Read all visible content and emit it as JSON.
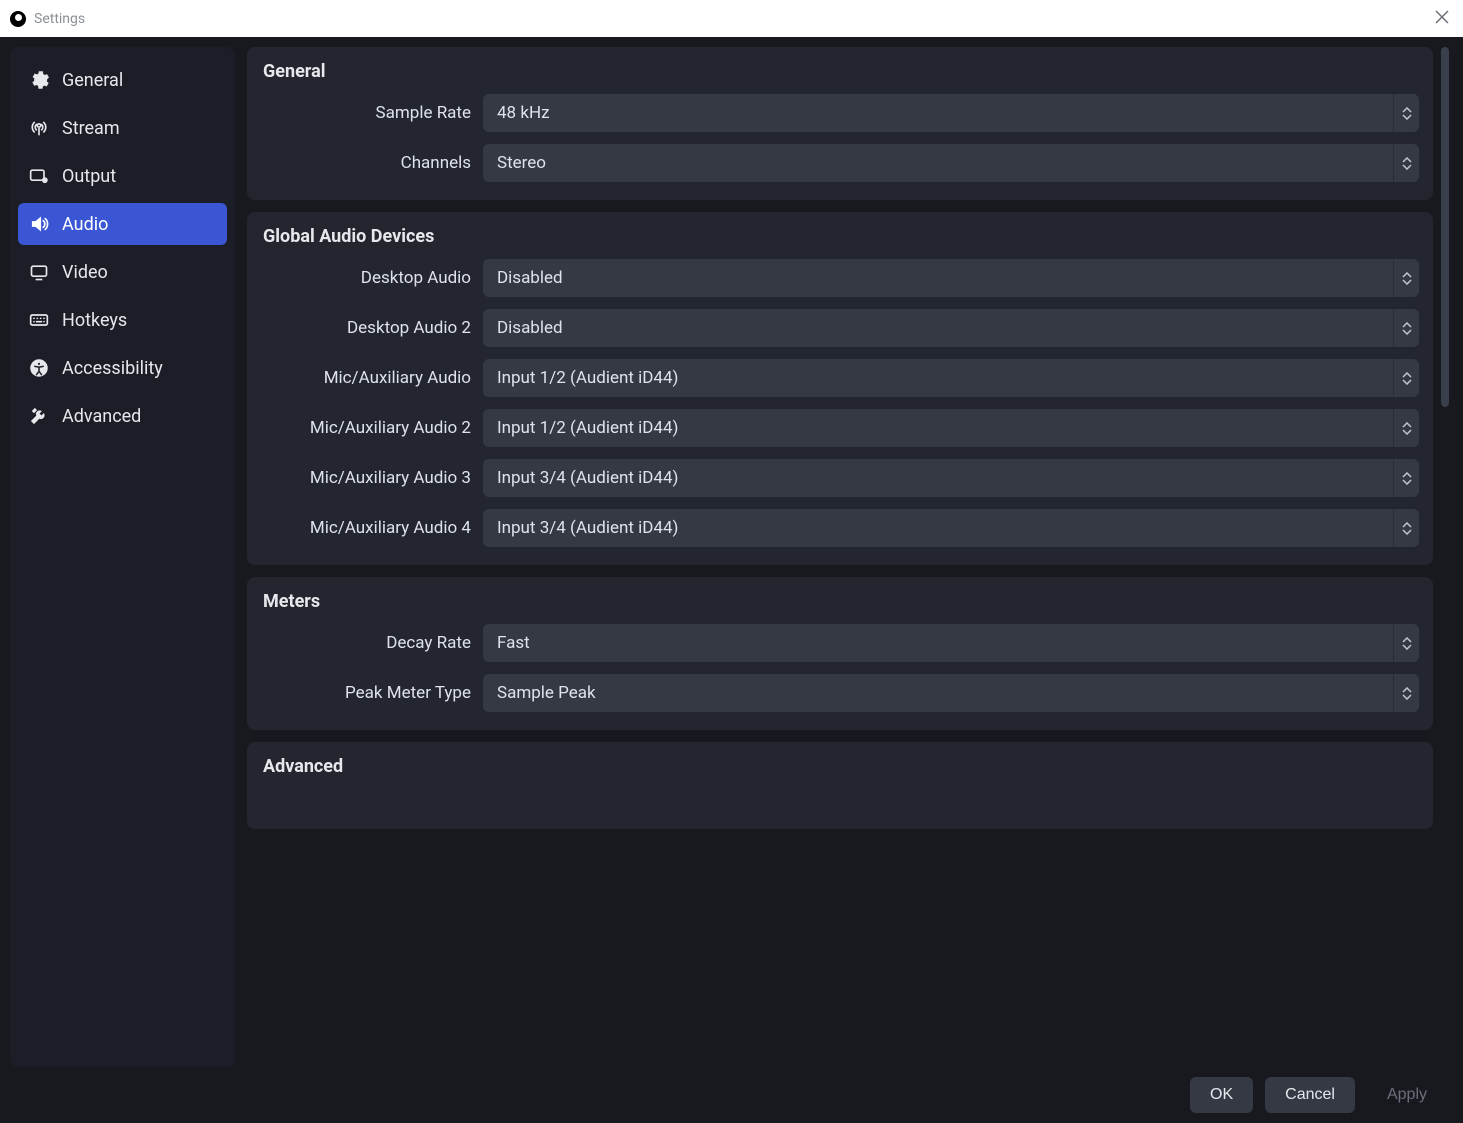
{
  "window": {
    "title": "Settings"
  },
  "sidebar": {
    "items": [
      {
        "id": "general",
        "label": "General"
      },
      {
        "id": "stream",
        "label": "Stream"
      },
      {
        "id": "output",
        "label": "Output"
      },
      {
        "id": "audio",
        "label": "Audio"
      },
      {
        "id": "video",
        "label": "Video"
      },
      {
        "id": "hotkeys",
        "label": "Hotkeys"
      },
      {
        "id": "accessibility",
        "label": "Accessibility"
      },
      {
        "id": "advanced",
        "label": "Advanced"
      }
    ],
    "active": "audio"
  },
  "sections": {
    "general": {
      "title": "General",
      "sample_rate": {
        "label": "Sample Rate",
        "value": "48 kHz"
      },
      "channels": {
        "label": "Channels",
        "value": "Stereo"
      }
    },
    "global_devices": {
      "title": "Global Audio Devices",
      "desktop_audio": {
        "label": "Desktop Audio",
        "value": "Disabled"
      },
      "desktop_audio_2": {
        "label": "Desktop Audio 2",
        "value": "Disabled"
      },
      "mic_aux": {
        "label": "Mic/Auxiliary Audio",
        "value": "Input 1/2 (Audient iD44)"
      },
      "mic_aux_2": {
        "label": "Mic/Auxiliary Audio 2",
        "value": "Input 1/2 (Audient iD44)"
      },
      "mic_aux_3": {
        "label": "Mic/Auxiliary Audio 3",
        "value": "Input 3/4 (Audient iD44)"
      },
      "mic_aux_4": {
        "label": "Mic/Auxiliary Audio 4",
        "value": "Input 3/4 (Audient iD44)"
      }
    },
    "meters": {
      "title": "Meters",
      "decay_rate": {
        "label": "Decay Rate",
        "value": "Fast"
      },
      "peak_meter": {
        "label": "Peak Meter Type",
        "value": "Sample Peak"
      }
    },
    "advanced": {
      "title": "Advanced"
    }
  },
  "footer": {
    "ok": "OK",
    "cancel": "Cancel",
    "apply": "Apply"
  }
}
